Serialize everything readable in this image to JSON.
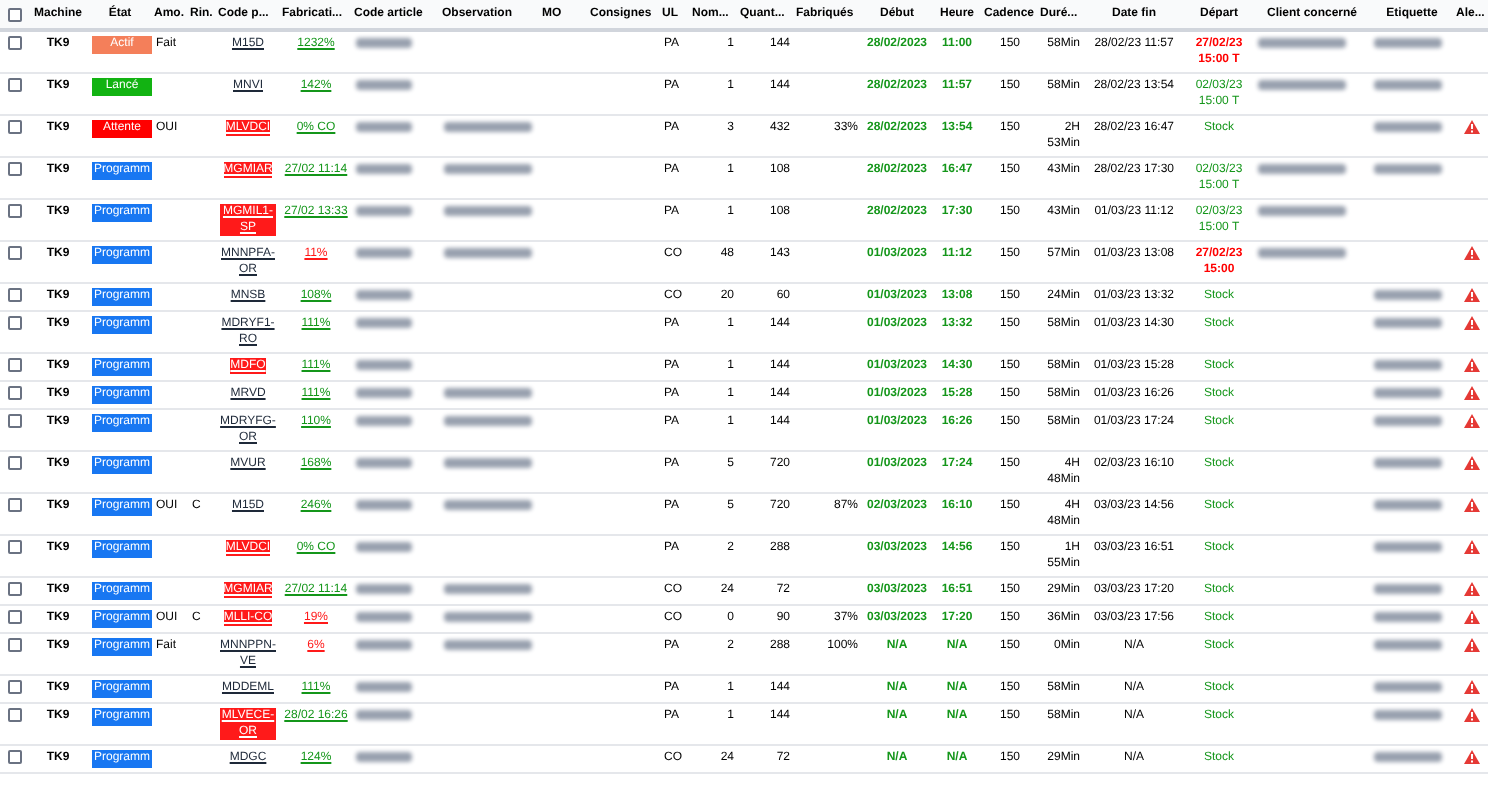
{
  "select_all": {
    "checked": false
  },
  "columns": [
    "Machine",
    "État",
    "Amo.",
    "Rin.",
    "Code p...",
    "Fabricati...",
    "Code article",
    "Observation",
    "MO",
    "Consignes",
    "UL",
    "Nom...",
    "Quant...",
    "Fabriqués",
    "Début",
    "Heure",
    "Cadence",
    "Duré...",
    "Date fin",
    "Départ",
    "Client concerné",
    "Etiquette",
    "Ale..."
  ],
  "rows": [
    {
      "checked": false,
      "machine": "TK9",
      "status": {
        "label": "Actif",
        "color": "#f47f5a"
      },
      "amo": "Fait",
      "code": {
        "text": "M15D",
        "highlighted": false
      },
      "fab": {
        "text": "1232%",
        "ok": true
      },
      "blurred": {
        "article": true,
        "observation": false,
        "client": true,
        "etiquette": true
      },
      "ul": "PA",
      "nom": "1",
      "qty": "144",
      "debut": "28/02/2023",
      "heure": "11:00",
      "cadence": "150",
      "duree": "58Min",
      "date_fin": "28/02/23 11:57",
      "depart": {
        "text": "27/02/23 15:00 T",
        "late": true
      },
      "alert": false
    },
    {
      "checked": false,
      "machine": "TK9",
      "status": {
        "label": "Lancé",
        "color": "#12b312"
      },
      "code": {
        "text": "MNVI",
        "highlighted": false
      },
      "fab": {
        "text": "142%",
        "ok": true
      },
      "blurred": {
        "article": true,
        "observation": false,
        "client": true,
        "etiquette": true
      },
      "ul": "PA",
      "nom": "1",
      "qty": "144",
      "debut": "28/02/2023",
      "heure": "11:57",
      "cadence": "150",
      "duree": "58Min",
      "date_fin": "28/02/23 13:54",
      "depart": {
        "text": "02/03/23 15:00 T",
        "late": false
      },
      "alert": false
    },
    {
      "checked": false,
      "machine": "TK9",
      "status": {
        "label": "Attente",
        "color": "#ff0000"
      },
      "amo": "OUI",
      "code": {
        "text": "MLVDCI",
        "highlighted": true
      },
      "fab": {
        "text": "0% CO",
        "ok": true
      },
      "blurred": {
        "article": true,
        "observation": true,
        "client": false,
        "etiquette": true
      },
      "ul": "PA",
      "nom": "3",
      "qty": "432",
      "fabriques": "33%",
      "debut": "28/02/2023",
      "heure": "13:54",
      "cadence": "150",
      "duree": "2H 53Min",
      "date_fin": "28/02/23 16:47",
      "depart": {
        "text": "Stock",
        "late": false
      },
      "alert": true
    },
    {
      "checked": false,
      "machine": "TK9",
      "status": {
        "label": "Programm",
        "color": "#1877f2"
      },
      "code": {
        "text": "MGMIAR",
        "highlighted": true
      },
      "fab": {
        "text": "27/02 11:14",
        "ok": true
      },
      "blurred": {
        "article": true,
        "observation": true,
        "client": true,
        "etiquette": true
      },
      "ul": "PA",
      "nom": "1",
      "qty": "108",
      "debut": "28/02/2023",
      "heure": "16:47",
      "cadence": "150",
      "duree": "43Min",
      "date_fin": "28/02/23 17:30",
      "depart": {
        "text": "02/03/23 15:00 T",
        "late": false
      },
      "alert": false
    },
    {
      "checked": false,
      "machine": "TK9",
      "status": {
        "label": "Programm",
        "color": "#1877f2"
      },
      "code": {
        "text": "MGMIL1-SP",
        "highlighted": true
      },
      "fab": {
        "text": "27/02 13:33",
        "ok": true
      },
      "blurred": {
        "article": true,
        "observation": true,
        "client": true,
        "etiquette": false
      },
      "ul": "PA",
      "nom": "1",
      "qty": "108",
      "debut": "28/02/2023",
      "heure": "17:30",
      "cadence": "150",
      "duree": "43Min",
      "date_fin": "01/03/23 11:12",
      "depart": {
        "text": "02/03/23 15:00 T",
        "late": false
      },
      "alert": false
    },
    {
      "checked": false,
      "machine": "TK9",
      "status": {
        "label": "Programm",
        "color": "#1877f2"
      },
      "code": {
        "text": "MNNPFA-OR",
        "highlighted": false
      },
      "fab": {
        "text": "11%",
        "ok": false
      },
      "blurred": {
        "article": true,
        "observation": true,
        "client": true,
        "etiquette": false
      },
      "ul": "CO",
      "nom": "48",
      "qty": "143",
      "debut": "01/03/2023",
      "heure": "11:12",
      "cadence": "150",
      "duree": "57Min",
      "date_fin": "01/03/23 13:08",
      "depart": {
        "text": "27/02/23 15:00",
        "late": true
      },
      "alert": true
    },
    {
      "checked": false,
      "machine": "TK9",
      "status": {
        "label": "Programm",
        "color": "#1877f2"
      },
      "code": {
        "text": "MNSB",
        "highlighted": false
      },
      "fab": {
        "text": "108%",
        "ok": true
      },
      "blurred": {
        "article": true,
        "observation": false,
        "client": false,
        "etiquette": true
      },
      "ul": "CO",
      "nom": "20",
      "qty": "60",
      "debut": "01/03/2023",
      "heure": "13:08",
      "cadence": "150",
      "duree": "24Min",
      "date_fin": "01/03/23 13:32",
      "depart": {
        "text": "Stock",
        "late": false
      },
      "alert": true
    },
    {
      "checked": false,
      "machine": "TK9",
      "status": {
        "label": "Programm",
        "color": "#1877f2"
      },
      "code": {
        "text": "MDRYF1-RO",
        "highlighted": false
      },
      "fab": {
        "text": "111%",
        "ok": true
      },
      "blurred": {
        "article": true,
        "observation": false,
        "client": false,
        "etiquette": true
      },
      "ul": "PA",
      "nom": "1",
      "qty": "144",
      "debut": "01/03/2023",
      "heure": "13:32",
      "cadence": "150",
      "duree": "58Min",
      "date_fin": "01/03/23 14:30",
      "depart": {
        "text": "Stock",
        "late": false
      },
      "alert": true
    },
    {
      "checked": false,
      "machine": "TK9",
      "status": {
        "label": "Programm",
        "color": "#1877f2"
      },
      "code": {
        "text": "MDFO",
        "highlighted": true
      },
      "fab": {
        "text": "111%",
        "ok": true
      },
      "blurred": {
        "article": true,
        "observation": false,
        "client": false,
        "etiquette": true
      },
      "ul": "PA",
      "nom": "1",
      "qty": "144",
      "debut": "01/03/2023",
      "heure": "14:30",
      "cadence": "150",
      "duree": "58Min",
      "date_fin": "01/03/23 15:28",
      "depart": {
        "text": "Stock",
        "late": false
      },
      "alert": true
    },
    {
      "checked": false,
      "machine": "TK9",
      "status": {
        "label": "Programm",
        "color": "#1877f2"
      },
      "code": {
        "text": "MRVD",
        "highlighted": false
      },
      "fab": {
        "text": "111%",
        "ok": true
      },
      "blurred": {
        "article": true,
        "observation": true,
        "client": false,
        "etiquette": true
      },
      "ul": "PA",
      "nom": "1",
      "qty": "144",
      "debut": "01/03/2023",
      "heure": "15:28",
      "cadence": "150",
      "duree": "58Min",
      "date_fin": "01/03/23 16:26",
      "depart": {
        "text": "Stock",
        "late": false
      },
      "alert": true
    },
    {
      "checked": false,
      "machine": "TK9",
      "status": {
        "label": "Programm",
        "color": "#1877f2"
      },
      "code": {
        "text": "MDRYFG-OR",
        "highlighted": false
      },
      "fab": {
        "text": "110%",
        "ok": true
      },
      "blurred": {
        "article": true,
        "observation": true,
        "client": false,
        "etiquette": true
      },
      "ul": "PA",
      "nom": "1",
      "qty": "144",
      "debut": "01/03/2023",
      "heure": "16:26",
      "cadence": "150",
      "duree": "58Min",
      "date_fin": "01/03/23 17:24",
      "depart": {
        "text": "Stock",
        "late": false
      },
      "alert": true
    },
    {
      "checked": false,
      "machine": "TK9",
      "status": {
        "label": "Programm",
        "color": "#1877f2"
      },
      "code": {
        "text": "MVUR",
        "highlighted": false
      },
      "fab": {
        "text": "168%",
        "ok": true
      },
      "blurred": {
        "article": true,
        "observation": true,
        "client": false,
        "etiquette": true
      },
      "ul": "PA",
      "nom": "5",
      "qty": "720",
      "debut": "01/03/2023",
      "heure": "17:24",
      "cadence": "150",
      "duree": "4H 48Min",
      "date_fin": "02/03/23 16:10",
      "depart": {
        "text": "Stock",
        "late": false
      },
      "alert": true
    },
    {
      "checked": false,
      "machine": "TK9",
      "status": {
        "label": "Programm",
        "color": "#1877f2"
      },
      "amo": "OUI",
      "rin": "C",
      "code": {
        "text": "M15D",
        "highlighted": false
      },
      "fab": {
        "text": "246%",
        "ok": true
      },
      "blurred": {
        "article": true,
        "observation": true,
        "client": false,
        "etiquette": true
      },
      "ul": "PA",
      "nom": "5",
      "qty": "720",
      "fabriques": "87%",
      "debut": "02/03/2023",
      "heure": "16:10",
      "cadence": "150",
      "duree": "4H 48Min",
      "date_fin": "03/03/23 14:56",
      "depart": {
        "text": "Stock",
        "late": false
      },
      "alert": true
    },
    {
      "checked": false,
      "machine": "TK9",
      "status": {
        "label": "Programm",
        "color": "#1877f2"
      },
      "code": {
        "text": "MLVDCI",
        "highlighted": true
      },
      "fab": {
        "text": "0% CO",
        "ok": true
      },
      "blurred": {
        "article": true,
        "observation": false,
        "client": false,
        "etiquette": true
      },
      "ul": "PA",
      "nom": "2",
      "qty": "288",
      "debut": "03/03/2023",
      "heure": "14:56",
      "cadence": "150",
      "duree": "1H 55Min",
      "date_fin": "03/03/23 16:51",
      "depart": {
        "text": "Stock",
        "late": false
      },
      "alert": true
    },
    {
      "checked": false,
      "machine": "TK9",
      "status": {
        "label": "Programm",
        "color": "#1877f2"
      },
      "code": {
        "text": "MGMIAR",
        "highlighted": true
      },
      "fab": {
        "text": "27/02 11:14",
        "ok": true
      },
      "blurred": {
        "article": true,
        "observation": true,
        "client": false,
        "etiquette": true
      },
      "ul": "CO",
      "nom": "24",
      "qty": "72",
      "debut": "03/03/2023",
      "heure": "16:51",
      "cadence": "150",
      "duree": "29Min",
      "date_fin": "03/03/23 17:20",
      "depart": {
        "text": "Stock",
        "late": false
      },
      "alert": true
    },
    {
      "checked": false,
      "machine": "TK9",
      "status": {
        "label": "Programm",
        "color": "#1877f2"
      },
      "amo": "OUI",
      "rin": "C",
      "code": {
        "text": "MLLI-CO",
        "highlighted": true
      },
      "fab": {
        "text": "19%",
        "ok": false
      },
      "blurred": {
        "article": true,
        "observation": true,
        "client": false,
        "etiquette": true
      },
      "ul": "CO",
      "nom": "0",
      "qty": "90",
      "fabriques": "37%",
      "debut": "03/03/2023",
      "heure": "17:20",
      "cadence": "150",
      "duree": "36Min",
      "date_fin": "03/03/23 17:56",
      "depart": {
        "text": "Stock",
        "late": false
      },
      "alert": true
    },
    {
      "checked": false,
      "machine": "TK9",
      "status": {
        "label": "Programm",
        "color": "#1877f2"
      },
      "amo": "Fait",
      "code": {
        "text": "MNNPPN-VE",
        "highlighted": false
      },
      "fab": {
        "text": "6%",
        "ok": false
      },
      "blurred": {
        "article": true,
        "observation": true,
        "client": false,
        "etiquette": true
      },
      "ul": "PA",
      "nom": "2",
      "qty": "288",
      "fabriques": "100%",
      "debut": "N/A",
      "heure": "N/A",
      "cadence": "150",
      "duree": "0Min",
      "date_fin": "N/A",
      "depart": {
        "text": "Stock",
        "late": false
      },
      "alert": true
    },
    {
      "checked": false,
      "machine": "TK9",
      "status": {
        "label": "Programm",
        "color": "#1877f2"
      },
      "code": {
        "text": "MDDEML",
        "highlighted": false
      },
      "fab": {
        "text": "111%",
        "ok": true
      },
      "blurred": {
        "article": true,
        "observation": false,
        "client": false,
        "etiquette": true
      },
      "ul": "PA",
      "nom": "1",
      "qty": "144",
      "debut": "N/A",
      "heure": "N/A",
      "cadence": "150",
      "duree": "58Min",
      "date_fin": "N/A",
      "depart": {
        "text": "Stock",
        "late": false
      },
      "alert": true
    },
    {
      "checked": false,
      "machine": "TK9",
      "status": {
        "label": "Programm",
        "color": "#1877f2"
      },
      "code": {
        "text": "MLVECE-OR",
        "highlighted": true
      },
      "fab": {
        "text": "28/02 16:26",
        "ok": true
      },
      "blurred": {
        "article": true,
        "observation": false,
        "client": false,
        "etiquette": true
      },
      "ul": "PA",
      "nom": "1",
      "qty": "144",
      "debut": "N/A",
      "heure": "N/A",
      "cadence": "150",
      "duree": "58Min",
      "date_fin": "N/A",
      "depart": {
        "text": "Stock",
        "late": false
      },
      "alert": true
    },
    {
      "checked": false,
      "machine": "TK9",
      "status": {
        "label": "Programm",
        "color": "#1877f2"
      },
      "code": {
        "text": "MDGC",
        "highlighted": false
      },
      "fab": {
        "text": "124%",
        "ok": true
      },
      "blurred": {
        "article": true,
        "observation": false,
        "client": false,
        "etiquette": true
      },
      "ul": "CO",
      "nom": "24",
      "qty": "72",
      "debut": "N/A",
      "heure": "N/A",
      "cadence": "150",
      "duree": "29Min",
      "date_fin": "N/A",
      "depart": {
        "text": "Stock",
        "late": false
      },
      "alert": true
    }
  ]
}
